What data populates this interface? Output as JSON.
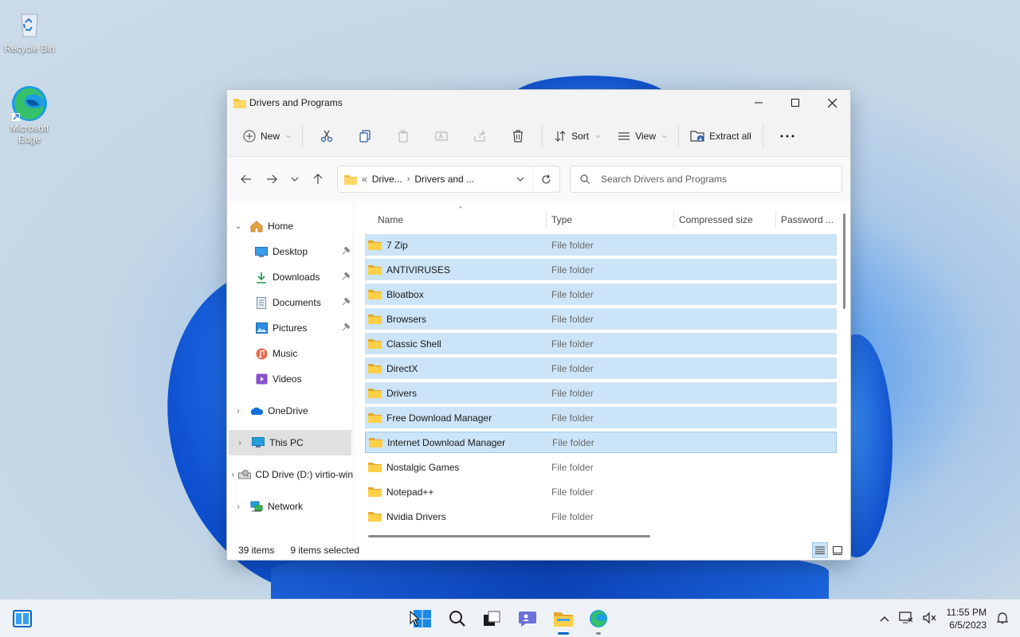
{
  "desktop": {
    "icons": [
      {
        "label": "Recycle Bin",
        "icon": "recycle-bin-icon"
      },
      {
        "label": "Microsoft Edge",
        "icon": "edge-icon"
      }
    ]
  },
  "window": {
    "title": "Drivers and Programs",
    "toolbar": {
      "new_label": "New",
      "sort_label": "Sort",
      "view_label": "View",
      "extract_label": "Extract all"
    },
    "address": {
      "crumb_prefix": "«",
      "crumbs": [
        "Drive...",
        "Drivers and ..."
      ]
    },
    "search": {
      "placeholder": "Search Drivers and Programs"
    },
    "nav": {
      "home": "Home",
      "quick": [
        {
          "label": "Desktop",
          "pinned": true
        },
        {
          "label": "Downloads",
          "pinned": true
        },
        {
          "label": "Documents",
          "pinned": true
        },
        {
          "label": "Pictures",
          "pinned": true
        },
        {
          "label": "Music",
          "pinned": false
        },
        {
          "label": "Videos",
          "pinned": false
        }
      ],
      "onedrive": "OneDrive",
      "thispc": "This PC",
      "cddrive": "CD Drive (D:) virtio-win",
      "network": "Network"
    },
    "columns": {
      "name": "Name",
      "type": "Type",
      "compressed": "Compressed size",
      "password": "Password ..."
    },
    "files": [
      {
        "name": "7 Zip",
        "type": "File folder",
        "selected": true
      },
      {
        "name": "ANTIVIRUSES",
        "type": "File folder",
        "selected": true
      },
      {
        "name": "Bloatbox",
        "type": "File folder",
        "selected": true
      },
      {
        "name": "Browsers",
        "type": "File folder",
        "selected": true
      },
      {
        "name": "Classic Shell",
        "type": "File folder",
        "selected": true
      },
      {
        "name": "DirectX",
        "type": "File folder",
        "selected": true
      },
      {
        "name": "Drivers",
        "type": "File folder",
        "selected": true
      },
      {
        "name": "Free Download Manager",
        "type": "File folder",
        "selected": true
      },
      {
        "name": "Internet Download Manager",
        "type": "File folder",
        "selected": true
      },
      {
        "name": "Nostalgic Games",
        "type": "File folder",
        "selected": false
      },
      {
        "name": "Notepad++",
        "type": "File folder",
        "selected": false
      },
      {
        "name": "Nvidia Drivers",
        "type": "File folder",
        "selected": false
      }
    ],
    "status": {
      "items": "39 items",
      "selected": "9 items selected"
    }
  },
  "taskbar": {
    "time": "11:55 PM",
    "date": "6/5/2023"
  },
  "colors": {
    "selection": "#cce4f7",
    "accent": "#0067c0",
    "folder": "#f4c542"
  }
}
